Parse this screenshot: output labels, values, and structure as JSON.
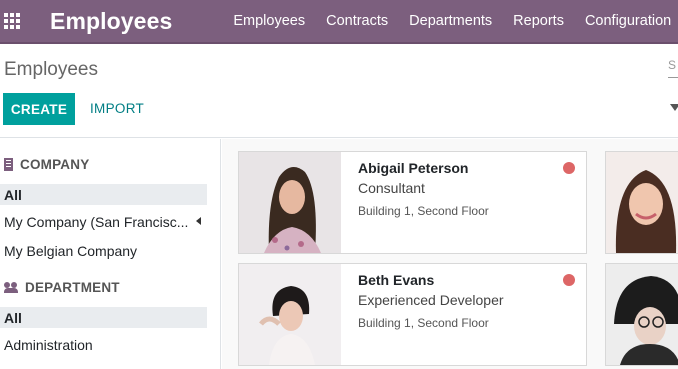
{
  "navbar": {
    "app_title": "Employees",
    "menu": [
      "Employees",
      "Contracts",
      "Departments",
      "Reports",
      "Configuration"
    ]
  },
  "control": {
    "breadcrumb": "Employees",
    "search_hint": "S",
    "create_label": "CREATE",
    "import_label": "IMPORT"
  },
  "sidebar": {
    "company_header": "COMPANY",
    "company_items": [
      "All",
      "My Company (San Francisc...",
      "My Belgian Company"
    ],
    "department_header": "DEPARTMENT",
    "department_items": [
      "All",
      "Administration"
    ]
  },
  "cards": [
    {
      "name": "Abigail Peterson",
      "job": "Consultant",
      "location": "Building 1, Second Floor",
      "status_color": "#dd6666"
    },
    {
      "name": "Beth Evans",
      "job": "Experienced Developer",
      "location": "Building 1, Second Floor",
      "status_color": "#dd6666"
    }
  ],
  "colors": {
    "brand": "#7c5f7e",
    "primary_button": "#00a09d",
    "link": "#017e84"
  },
  "icons": {
    "apps": "apps-grid-icon",
    "company": "building-icon",
    "department": "users-icon",
    "filter": "filter-icon"
  }
}
